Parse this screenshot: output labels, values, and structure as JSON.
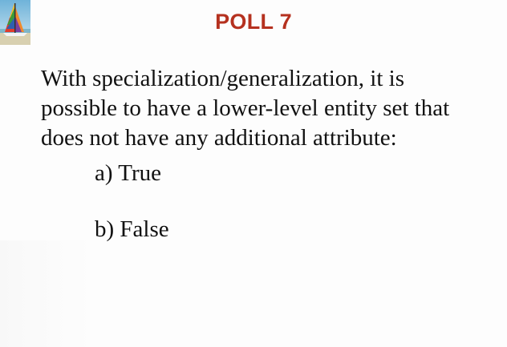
{
  "slide": {
    "title": "POLL 7",
    "question_lines": [
      "With specialization/generalization, it is",
      "possible to have a lower-level entity set that",
      "does not have any additional attribute:"
    ],
    "options": [
      {
        "label": "a) True"
      },
      {
        "label": "b) False"
      }
    ],
    "logo_icon": "sailboat-icon",
    "colors": {
      "title": "#b5311f",
      "text": "#111111"
    }
  }
}
